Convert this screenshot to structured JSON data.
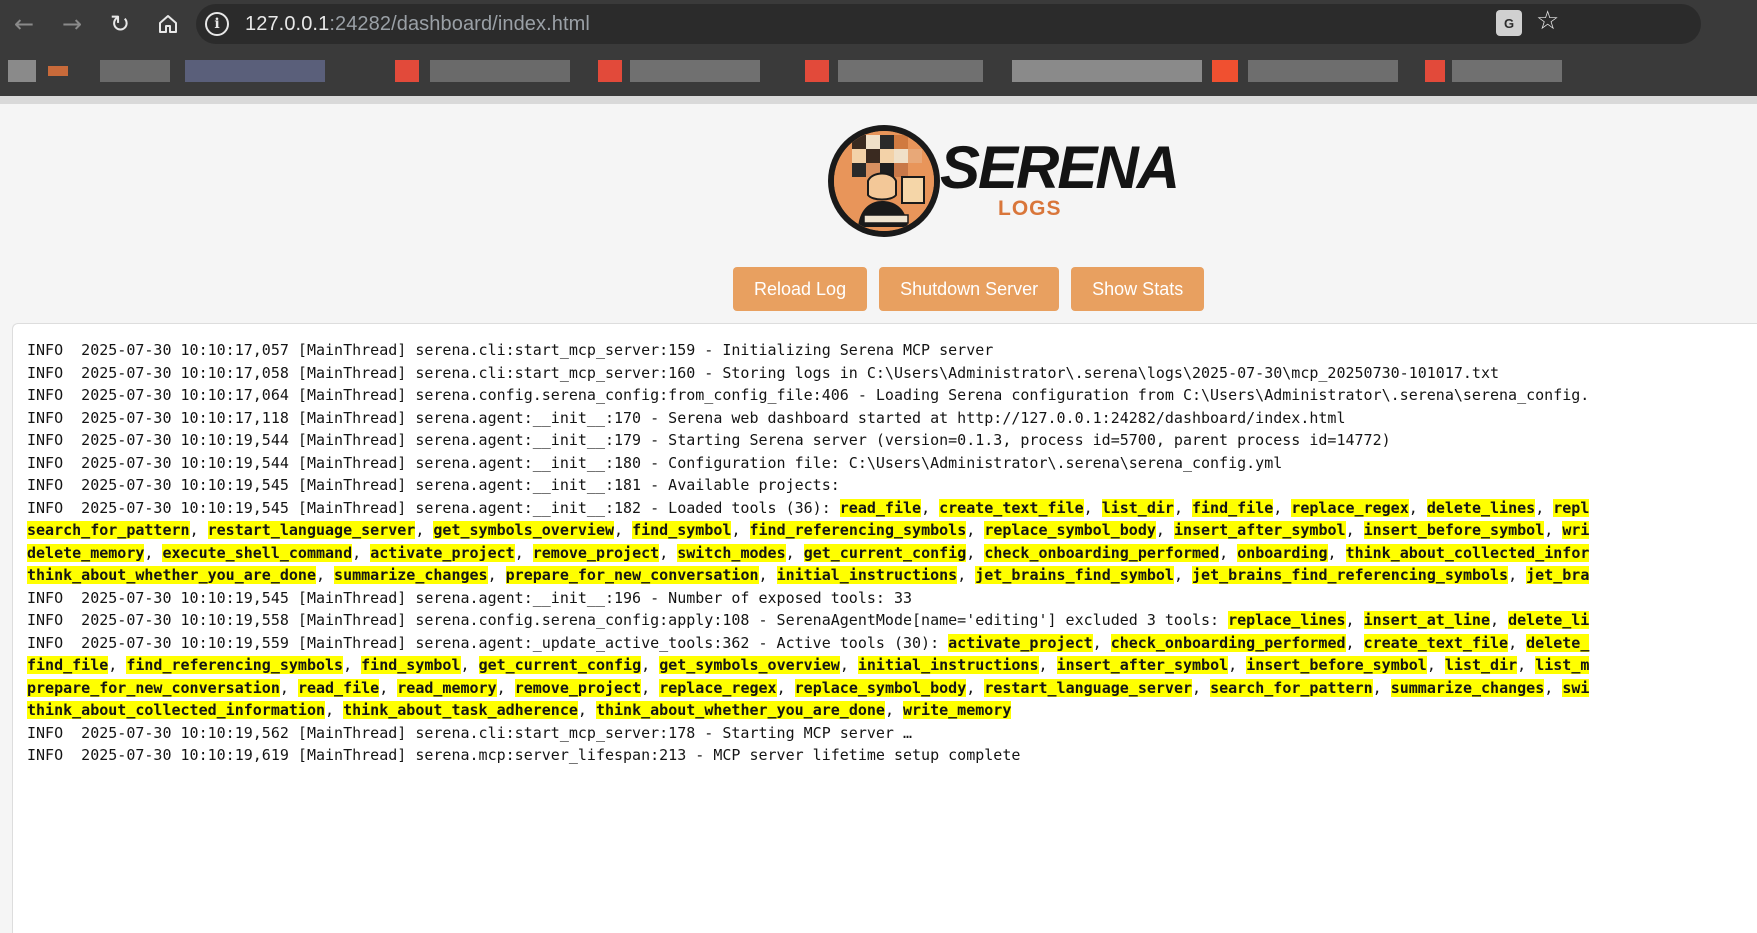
{
  "browser": {
    "url_host": "127.0.0.1",
    "url_rest": ":24282/dashboard/index.html"
  },
  "logo": {
    "title": "SERENA",
    "subtitle": "LOGS"
  },
  "buttons": {
    "reload": "Reload Log",
    "shutdown": "Shutdown Server",
    "stats": "Show Stats"
  },
  "log_lines": [
    {
      "text": "INFO  2025-07-30 10:10:17,057 [MainThread] serena.cli:start_mcp_server:159 - Initializing Serena MCP server"
    },
    {
      "text": "INFO  2025-07-30 10:10:17,058 [MainThread] serena.cli:start_mcp_server:160 - Storing logs in C:\\Users\\Administrator\\.serena\\logs\\2025-07-30\\mcp_20250730-101017.txt"
    },
    {
      "text": "INFO  2025-07-30 10:10:17,064 [MainThread] serena.config.serena_config:from_config_file:406 - Loading Serena configuration from C:\\Users\\Administrator\\.serena\\serena_config."
    },
    {
      "text": "INFO  2025-07-30 10:10:17,118 [MainThread] serena.agent:__init__:170 - Serena web dashboard started at http://127.0.0.1:24282/dashboard/index.html"
    },
    {
      "text": "INFO  2025-07-30 10:10:19,544 [MainThread] serena.agent:__init__:179 - Starting Serena server (version=0.1.3, process id=5700, parent process id=14772)"
    },
    {
      "text": "INFO  2025-07-30 10:10:19,544 [MainThread] serena.agent:__init__:180 - Configuration file: C:\\Users\\Administrator\\.serena\\serena_config.yml"
    },
    {
      "text": "INFO  2025-07-30 10:10:19,545 [MainThread] serena.agent:__init__:181 - Available projects:"
    },
    {
      "prefix": "INFO  2025-07-30 10:10:19,545 [MainThread] serena.agent:__init__:182 - Loaded tools (36): ",
      "tools": [
        "read_file",
        "create_text_file",
        "list_dir",
        "find_file",
        "replace_regex",
        "delete_lines",
        "repl"
      ]
    },
    {
      "prefix": "",
      "tools": [
        "search_for_pattern",
        "restart_language_server",
        "get_symbols_overview",
        "find_symbol",
        "find_referencing_symbols",
        "replace_symbol_body",
        "insert_after_symbol",
        "insert_before_symbol",
        "wri"
      ]
    },
    {
      "prefix": "",
      "tools": [
        "delete_memory",
        "execute_shell_command",
        "activate_project",
        "remove_project",
        "switch_modes",
        "get_current_config",
        "check_onboarding_performed",
        "onboarding",
        "think_about_collected_infor"
      ]
    },
    {
      "prefix": "",
      "tools": [
        "think_about_whether_you_are_done",
        "summarize_changes",
        "prepare_for_new_conversation",
        "initial_instructions",
        "jet_brains_find_symbol",
        "jet_brains_find_referencing_symbols",
        "jet_bra"
      ]
    },
    {
      "text": "INFO  2025-07-30 10:10:19,545 [MainThread] serena.agent:__init__:196 - Number of exposed tools: 33"
    },
    {
      "prefix": "INFO  2025-07-30 10:10:19,558 [MainThread] serena.config.serena_config:apply:108 - SerenaAgentMode[name='editing'] excluded 3 tools: ",
      "tools": [
        "replace_lines",
        "insert_at_line",
        "delete_li"
      ]
    },
    {
      "prefix": "INFO  2025-07-30 10:10:19,559 [MainThread] serena.agent:_update_active_tools:362 - Active tools (30): ",
      "tools": [
        "activate_project",
        "check_onboarding_performed",
        "create_text_file",
        "delete_"
      ]
    },
    {
      "prefix": "",
      "tools": [
        "find_file",
        "find_referencing_symbols",
        "find_symbol",
        "get_current_config",
        "get_symbols_overview",
        "initial_instructions",
        "insert_after_symbol",
        "insert_before_symbol",
        "list_dir",
        "list_m"
      ]
    },
    {
      "prefix": "",
      "tools": [
        "prepare_for_new_conversation",
        "read_file",
        "read_memory",
        "remove_project",
        "replace_regex",
        "replace_symbol_body",
        "restart_language_server",
        "search_for_pattern",
        "summarize_changes",
        "swi"
      ]
    },
    {
      "prefix": "",
      "tools": [
        "think_about_collected_information",
        "think_about_task_adherence",
        "think_about_whether_you_are_done",
        "write_memory"
      ]
    },
    {
      "text": "INFO  2025-07-30 10:10:19,562 [MainThread] serena.cli:start_mcp_server:178 - Starting MCP server …"
    },
    {
      "text": "INFO  2025-07-30 10:10:19,619 [MainThread] serena.mcp:server_lifespan:213 - MCP server lifetime setup complete"
    }
  ],
  "colors": {
    "button": "#e8a060",
    "highlight": "#ffff00",
    "chrome": "#3a3a3a",
    "logo_orange": "#e8955a"
  },
  "icons": [
    "back-arrow-icon",
    "forward-arrow-icon",
    "reload-icon",
    "home-icon",
    "info-icon",
    "translate-icon",
    "star-icon"
  ]
}
